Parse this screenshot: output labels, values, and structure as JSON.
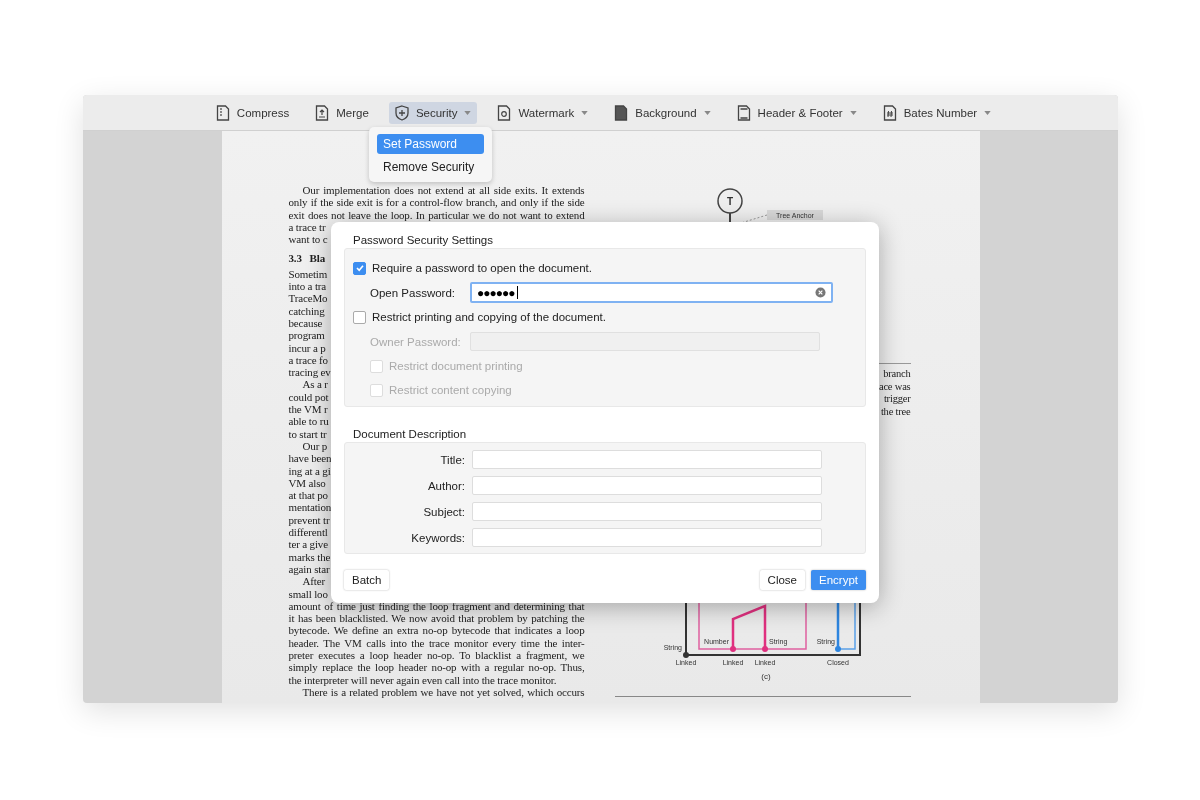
{
  "toolbar": [
    {
      "label": "Compress",
      "dropdown": false,
      "selected": false
    },
    {
      "label": "Merge",
      "dropdown": false,
      "selected": false
    },
    {
      "label": "Security",
      "dropdown": true,
      "selected": true
    },
    {
      "label": "Watermark",
      "dropdown": true,
      "selected": false
    },
    {
      "label": "Background",
      "dropdown": true,
      "selected": false
    },
    {
      "label": "Header & Footer",
      "dropdown": true,
      "selected": false
    },
    {
      "label": "Bates Number",
      "dropdown": true,
      "selected": false
    }
  ],
  "security_menu": [
    {
      "label": "Set Password",
      "selected": true
    },
    {
      "label": "Remove Security",
      "selected": false
    }
  ],
  "document": {
    "left_column": [
      {
        "text": "Our implementation does not extend at all side exits. It extends",
        "kind": "indent-justified"
      },
      {
        "text": "only if the side exit is for a control-flow branch, and only if the side",
        "kind": "justified"
      },
      {
        "text": "exit does not leave the loop. In particular we do not want to extend",
        "kind": "justified"
      },
      {
        "text": "a trace tr",
        "kind": "plain"
      },
      {
        "text": "want to c",
        "kind": "plain"
      },
      {
        "text": "3.3   Bla",
        "kind": "heading"
      },
      {
        "text": "Sometim",
        "kind": "plain"
      },
      {
        "text": "into a tra",
        "kind": "plain"
      },
      {
        "text": "TraceMo",
        "kind": "plain"
      },
      {
        "text": "catching",
        "kind": "plain"
      },
      {
        "text": "because",
        "kind": "plain"
      },
      {
        "text": "program",
        "kind": "plain"
      },
      {
        "text": "incur a p",
        "kind": "plain"
      },
      {
        "text": "a trace fo",
        "kind": "plain"
      },
      {
        "text": "tracing ev",
        "kind": "plain"
      },
      {
        "text": "As a r",
        "kind": "indent-plain"
      },
      {
        "text": "could pot",
        "kind": "plain"
      },
      {
        "text": "the VM r",
        "kind": "plain"
      },
      {
        "text": "able to ru",
        "kind": "plain"
      },
      {
        "text": "to start tr",
        "kind": "plain"
      },
      {
        "text": "Our p",
        "kind": "indent-plain"
      },
      {
        "text": "have been",
        "kind": "plain"
      },
      {
        "text": "ing at a gi",
        "kind": "plain"
      },
      {
        "text": "VM also",
        "kind": "plain"
      },
      {
        "text": "at that po",
        "kind": "plain"
      },
      {
        "text": "mentation",
        "kind": "plain"
      },
      {
        "text": "prevent tr",
        "kind": "plain"
      },
      {
        "text": "differentl",
        "kind": "plain"
      },
      {
        "text": "ter a give",
        "kind": "plain"
      },
      {
        "text": "marks the",
        "kind": "plain"
      },
      {
        "text": "again star",
        "kind": "plain"
      },
      {
        "text": "After",
        "kind": "indent-plain"
      },
      {
        "text": "small loo",
        "kind": "plain"
      },
      {
        "text": "amount of time just finding the loop fragment and determining that",
        "kind": "justified"
      },
      {
        "text": "it has been blacklisted. We now avoid that problem by patching the",
        "kind": "justified"
      },
      {
        "text": "bytecode. We define an extra no-op bytecode that indicates a loop",
        "kind": "justified"
      },
      {
        "text": "header. The VM calls into the trace monitor every time the inter-",
        "kind": "justified"
      },
      {
        "text": "preter executes a loop header no-op. To blacklist a fragment, we",
        "kind": "justified"
      },
      {
        "text": "simply replace the loop header no-op with a regular no-op. Thus,",
        "kind": "justified"
      },
      {
        "text": "the interpreter will never again even call into the trace monitor.",
        "kind": "plain"
      },
      {
        "text": "There is a related problem we have not yet solved, which occurs",
        "kind": "indent-justified"
      }
    ],
    "diagram_top": {
      "node": "T",
      "anchor": "Tree Anchor"
    },
    "right_column": [
      "branch",
      "ace was",
      "trigger",
      "the tree"
    ],
    "diagram_bottom": {
      "labels": [
        "String",
        "Linked",
        "Number",
        "Linked",
        "String",
        "Linked",
        "String",
        "Closed"
      ],
      "caption": "(c)"
    }
  },
  "dialog": {
    "security_title": "Password Security Settings",
    "require_password": {
      "label": "Require a password to open the document.",
      "checked": true
    },
    "open_password": {
      "label": "Open Password:",
      "value": "●●●●●●"
    },
    "restrict": {
      "label": "Restrict printing and copying of the document.",
      "checked": false
    },
    "owner_password": {
      "label": "Owner Password:",
      "disabled": true
    },
    "restrict_options": [
      {
        "label": "Restrict document printing",
        "checked": false,
        "disabled": true
      },
      {
        "label": "Restrict content copying",
        "checked": false,
        "disabled": true
      }
    ],
    "description_title": "Document Description",
    "fields": [
      {
        "label": "Title:"
      },
      {
        "label": "Author:"
      },
      {
        "label": "Subject:"
      },
      {
        "label": "Keywords:"
      }
    ],
    "buttons": [
      {
        "label": "Batch",
        "kind": "secondary"
      },
      {
        "label": "Close",
        "kind": "secondary"
      },
      {
        "label": "Encrypt",
        "kind": "primary"
      }
    ]
  }
}
